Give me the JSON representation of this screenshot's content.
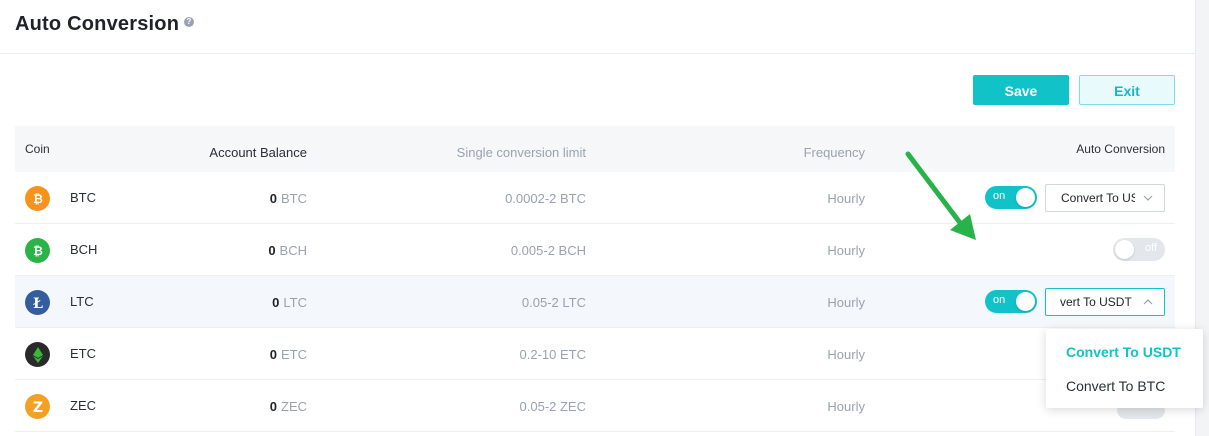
{
  "header": {
    "title": "Auto Conversion",
    "help_icon": "question-icon"
  },
  "toolbar": {
    "save_label": "Save",
    "exit_label": "Exit"
  },
  "table": {
    "columns": {
      "coin": "Coin",
      "balance": "Account Balance",
      "limit": "Single conversion limit",
      "frequency": "Frequency",
      "auto": "Auto Conversion"
    },
    "rows": [
      {
        "coin": "BTC",
        "balance": "0",
        "unit": "BTC",
        "limit": "0.0002-2 BTC",
        "frequency": "Hourly",
        "toggle": "on",
        "select": "Convert To US"
      },
      {
        "coin": "BCH",
        "balance": "0",
        "unit": "BCH",
        "limit": "0.005-2 BCH",
        "frequency": "Hourly",
        "toggle": "off",
        "select": ""
      },
      {
        "coin": "LTC",
        "balance": "0",
        "unit": "LTC",
        "limit": "0.05-2 LTC",
        "frequency": "Hourly",
        "toggle": "on",
        "select": "vert To USDT"
      },
      {
        "coin": "ETC",
        "balance": "0",
        "unit": "ETC",
        "limit": "0.2-10 ETC",
        "frequency": "Hourly",
        "toggle": "",
        "select": ""
      },
      {
        "coin": "ZEC",
        "balance": "0",
        "unit": "ZEC",
        "limit": "0.05-2 ZEC",
        "frequency": "Hourly",
        "toggle": "",
        "select": ""
      }
    ]
  },
  "dropdown": {
    "options": [
      "Convert To USDT",
      "Convert To BTC"
    ],
    "selected": "Convert To USDT"
  },
  "colors": {
    "accent": "#11c3c8",
    "btc": "#f7931a",
    "bch": "#2bb34a",
    "ltc": "#345d9d",
    "etc": "#2a2a2a",
    "zec": "#f4a024",
    "arrow": "#27b24a"
  }
}
